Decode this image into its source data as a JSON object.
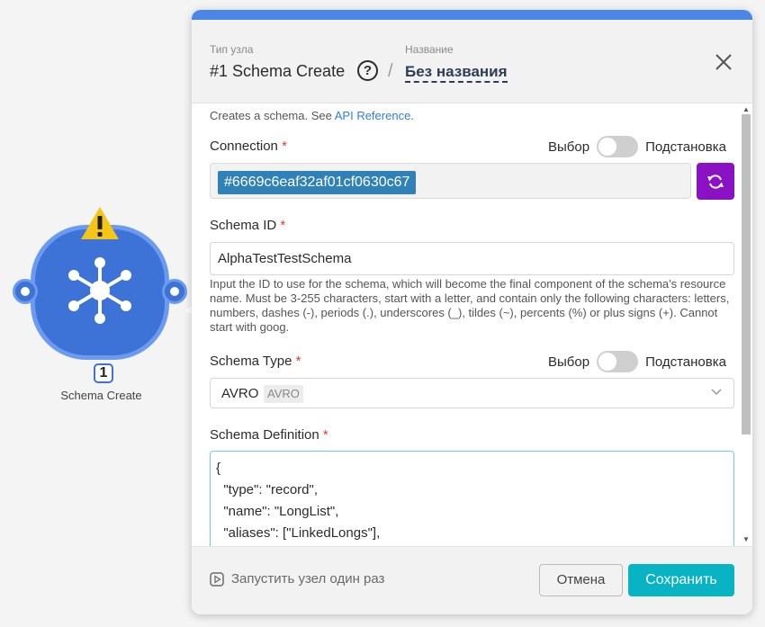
{
  "node": {
    "number": "1",
    "label": "Schema Create",
    "warning_icon": "warning-triangle-icon",
    "icon": "hub-network-icon"
  },
  "header": {
    "type_caption": "Тип узла",
    "type_title": "#1 Schema Create",
    "name_caption": "Название",
    "name_value": "Без названия"
  },
  "description": {
    "text": "Creates a schema. See ",
    "link": "API Reference",
    "suffix": "."
  },
  "connection": {
    "label": "Connection",
    "required": "*",
    "toggle_left": "Выбор",
    "toggle_right": "Подстановка",
    "value": "#6669c6eaf32af01cf0630c67"
  },
  "schema_id": {
    "label": "Schema ID",
    "required": "*",
    "value": "AlphaTestTestSchema",
    "hint": "Input the ID to use for the schema, which will become the final component of the schema's resource name. Must be 3-255 characters, start with a letter, and contain only the following characters: letters, numbers, dashes (-), periods (.), underscores (_), tildes (~), percents (%) or plus signs (+). Cannot start with goog."
  },
  "schema_type": {
    "label": "Schema Type",
    "required": "*",
    "toggle_left": "Выбор",
    "toggle_right": "Подстановка",
    "value": "AVRO",
    "tag": "AVRO"
  },
  "schema_definition": {
    "label": "Schema Definition",
    "required": "*",
    "lines": [
      "{",
      "  \"type\": \"record\",",
      "  \"name\": \"LongList\",",
      "  \"aliases\": [\"LinkedLongs\"],"
    ]
  },
  "footer": {
    "run_once": "Запустить узел один раз",
    "cancel": "Отмена",
    "save": "Сохранить"
  },
  "colors": {
    "accent": "#4a86e8",
    "node": "#3d72d6",
    "chip": "#2f81b8",
    "refresh": "#8a12c4",
    "save": "#08b3c4"
  }
}
